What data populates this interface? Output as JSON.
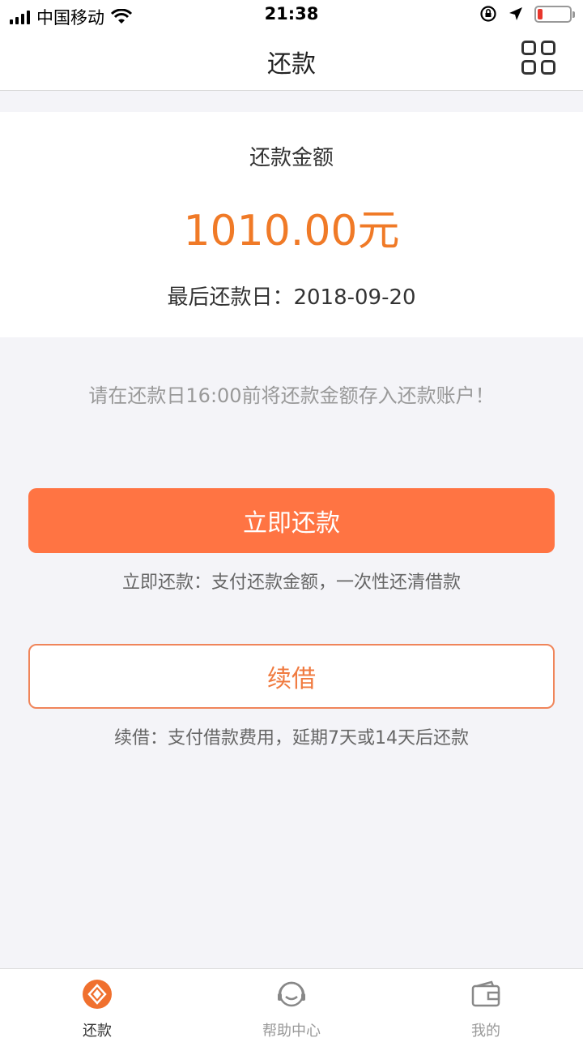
{
  "status_bar": {
    "carrier": "中国移动",
    "time": "21:38"
  },
  "nav": {
    "title": "还款",
    "menu_icon": "grid-icon"
  },
  "amount": {
    "label": "还款金额",
    "value": "1010.00元",
    "due_label": "最后还款日：",
    "due_date": "2018-09-20"
  },
  "tip": "请在还款日16:00前将还款金额存入还款账户！",
  "actions": {
    "repay_label": "立即还款",
    "repay_desc": "立即还款：支付还款金额，一次性还清借款",
    "renew_label": "续借",
    "renew_desc": "续借：支付借款费用，延期7天或14天后还款"
  },
  "tabs": [
    {
      "label": "还款",
      "icon": "repay-icon",
      "active": true
    },
    {
      "label": "帮助中心",
      "icon": "help-center-icon",
      "active": false
    },
    {
      "label": "我的",
      "icon": "wallet-icon",
      "active": false
    }
  ],
  "colors": {
    "accent": "#ff7443",
    "amount": "#f07a27",
    "background": "#f4f4f8"
  }
}
